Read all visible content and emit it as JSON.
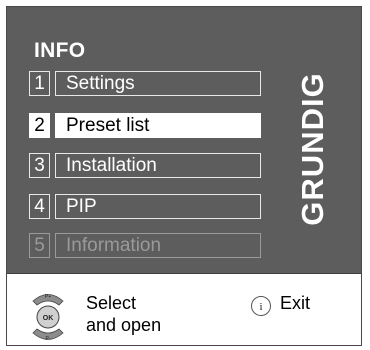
{
  "menu": {
    "title": "INFO",
    "items": [
      {
        "number": "1",
        "label": "Settings",
        "state": "normal"
      },
      {
        "number": "2",
        "label": "Preset list",
        "state": "selected"
      },
      {
        "number": "3",
        "label": "Installation",
        "state": "normal"
      },
      {
        "number": "4",
        "label": "PIP",
        "state": "normal"
      },
      {
        "number": "5",
        "label": "Information",
        "state": "disabled"
      }
    ]
  },
  "brand": "GRUNDIG",
  "footer": {
    "rocker": {
      "up_label": "P+",
      "center_label": "OK",
      "down_label": "P-"
    },
    "select_line1": "Select",
    "select_line2": "and open",
    "info_icon_label": "i",
    "exit_label": "Exit"
  },
  "colors": {
    "panel": "#5d5d5d",
    "selected_bg": "#ffffff",
    "disabled_text": "#9a9a9a"
  }
}
